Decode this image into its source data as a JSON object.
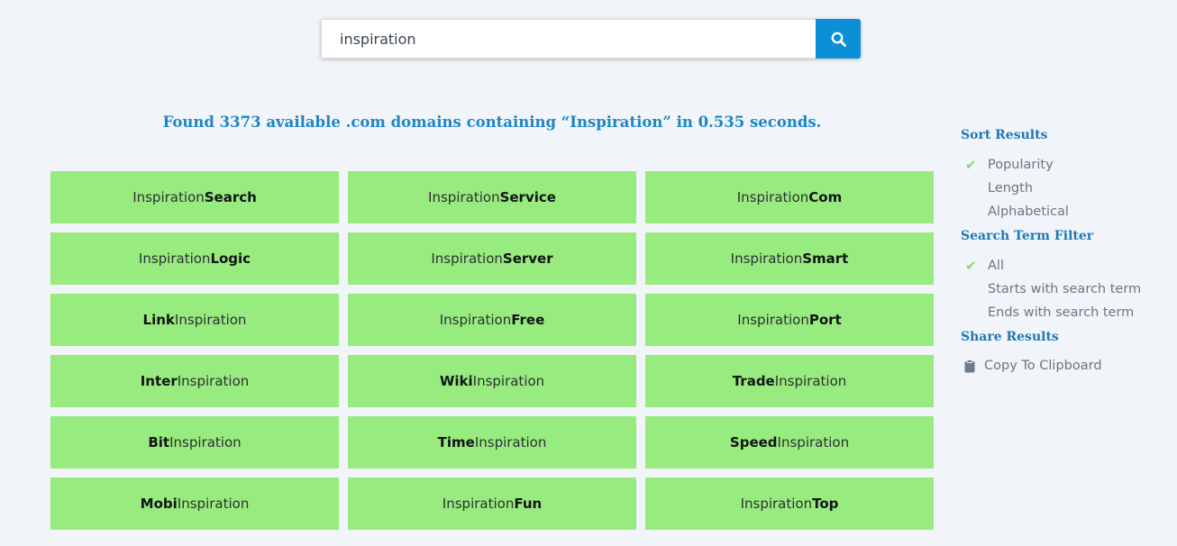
{
  "search": {
    "value": "inspiration",
    "button_icon": "search-icon"
  },
  "summary": "Found 3373 available .com domains containing “Inspiration” in 0.535 seconds.",
  "results": [
    {
      "pre": "Inspiration",
      "bold": "Search",
      "post": ""
    },
    {
      "pre": "Inspiration",
      "bold": "Service",
      "post": ""
    },
    {
      "pre": "Inspiration",
      "bold": "Com",
      "post": ""
    },
    {
      "pre": "Inspiration",
      "bold": "Logic",
      "post": ""
    },
    {
      "pre": "Inspiration",
      "bold": "Server",
      "post": ""
    },
    {
      "pre": "Inspiration",
      "bold": "Smart",
      "post": ""
    },
    {
      "pre": "",
      "bold": "Link",
      "post": "Inspiration"
    },
    {
      "pre": "Inspiration",
      "bold": "Free",
      "post": ""
    },
    {
      "pre": "Inspiration",
      "bold": "Port",
      "post": ""
    },
    {
      "pre": "",
      "bold": "Inter",
      "post": "Inspiration"
    },
    {
      "pre": "",
      "bold": "Wiki",
      "post": "Inspiration"
    },
    {
      "pre": "",
      "bold": "Trade",
      "post": "Inspiration"
    },
    {
      "pre": "",
      "bold": "Bit",
      "post": "Inspiration"
    },
    {
      "pre": "",
      "bold": "Time",
      "post": "Inspiration"
    },
    {
      "pre": "",
      "bold": "Speed",
      "post": "Inspiration"
    },
    {
      "pre": "",
      "bold": "Mobi",
      "post": "Inspiration"
    },
    {
      "pre": "Inspiration",
      "bold": "Fun",
      "post": ""
    },
    {
      "pre": "Inspiration",
      "bold": "Top",
      "post": ""
    }
  ],
  "sidebar": {
    "sort": {
      "title": "Sort Results",
      "options": [
        {
          "label": "Popularity",
          "selected": true
        },
        {
          "label": "Length",
          "selected": false
        },
        {
          "label": "Alphabetical",
          "selected": false
        }
      ]
    },
    "filter": {
      "title": "Search Term Filter",
      "options": [
        {
          "label": "All",
          "selected": true
        },
        {
          "label": "Starts with search term",
          "selected": false
        },
        {
          "label": "Ends with search term",
          "selected": false
        }
      ]
    },
    "share": {
      "title": "Share Results",
      "copy_label": "Copy To Clipboard",
      "copy_icon": "clipboard-icon"
    }
  },
  "colors": {
    "accent": "#0b8fd6",
    "result_bg": "#98eb7e",
    "check": "#8fd775",
    "heading": "#1f78b4"
  }
}
